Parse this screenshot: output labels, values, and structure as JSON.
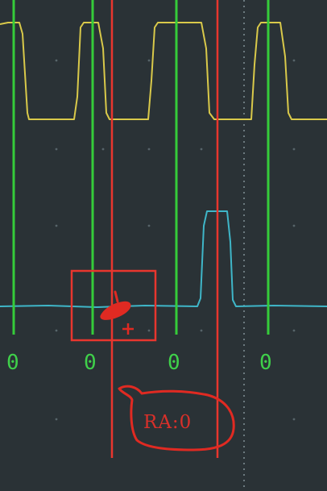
{
  "colors": {
    "background": "#2a3236",
    "grid_dot": "#6b7a80",
    "yellow_trace": "#d9c94a",
    "cyan_trace": "#3fb6c8",
    "green_marker": "#35cc3a",
    "red_cursor": "#e8362e",
    "red_annotation": "#e02a22"
  },
  "channel_labels": [
    "0",
    "0",
    "0",
    "0"
  ],
  "ra_readout": "RA:0",
  "icons": {
    "selection_box": "red-rect-selection",
    "pointer": "red-crosshair-pointer"
  }
}
